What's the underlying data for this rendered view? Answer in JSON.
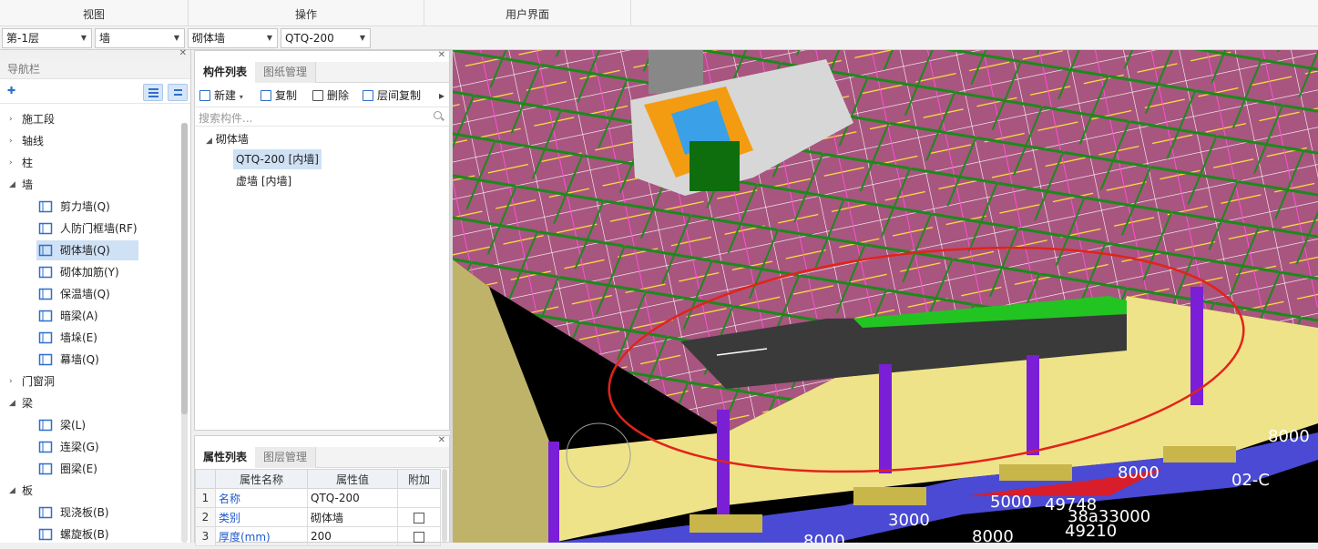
{
  "ribbon": {
    "groups": [
      "视图",
      "操作",
      "用户界面"
    ]
  },
  "selectors": [
    {
      "value": "第-1层"
    },
    {
      "value": "墙"
    },
    {
      "value": "砌体墙"
    },
    {
      "value": "QTQ-200"
    }
  ],
  "nav": {
    "title": "导航栏",
    "items": [
      {
        "type": "cat",
        "label": "施工段",
        "expanded": false
      },
      {
        "type": "cat",
        "label": "轴线",
        "expanded": false
      },
      {
        "type": "cat",
        "label": "柱",
        "expanded": false
      },
      {
        "type": "cat",
        "label": "墙",
        "expanded": true
      },
      {
        "type": "item",
        "label": "剪力墙(Q)",
        "icon": "shear-wall-icon"
      },
      {
        "type": "item",
        "label": "人防门框墙(RF)",
        "icon": "civil-defense-door-wall-icon"
      },
      {
        "type": "item",
        "label": "砌体墙(Q)",
        "icon": "masonry-wall-icon",
        "selected": true
      },
      {
        "type": "item",
        "label": "砌体加筋(Y)",
        "icon": "masonry-rebar-icon"
      },
      {
        "type": "item",
        "label": "保温墙(Q)",
        "icon": "insulation-wall-icon"
      },
      {
        "type": "item",
        "label": "暗梁(A)",
        "icon": "hidden-beam-icon"
      },
      {
        "type": "item",
        "label": "墙垛(E)",
        "icon": "wall-pier-icon"
      },
      {
        "type": "item",
        "label": "幕墙(Q)",
        "icon": "curtain-wall-icon"
      },
      {
        "type": "cat",
        "label": "门窗洞",
        "expanded": false
      },
      {
        "type": "cat",
        "label": "梁",
        "expanded": true
      },
      {
        "type": "item",
        "label": "梁(L)",
        "icon": "beam-icon"
      },
      {
        "type": "item",
        "label": "连梁(G)",
        "icon": "coupling-beam-icon"
      },
      {
        "type": "item",
        "label": "圈梁(E)",
        "icon": "ring-beam-icon"
      },
      {
        "type": "cat",
        "label": "板",
        "expanded": true
      },
      {
        "type": "item",
        "label": "现浇板(B)",
        "icon": "cast-slab-icon"
      },
      {
        "type": "item",
        "label": "螺旋板(B)",
        "icon": "spiral-slab-icon"
      }
    ]
  },
  "component_panel": {
    "tabs": [
      "构件列表",
      "图纸管理"
    ],
    "toolbar": {
      "new": "新建",
      "copy": "复制",
      "delete": "删除",
      "floor_copy": "层间复制"
    },
    "search_placeholder": "搜索构件...",
    "tree_root": "砌体墙",
    "tree_items": [
      "QTQ-200 [内墙]",
      "虚墙 [内墙]"
    ]
  },
  "property_panel": {
    "tabs": [
      "属性列表",
      "图层管理"
    ],
    "headers": [
      "属性名称",
      "属性值",
      "附加"
    ],
    "rows": [
      {
        "n": "1",
        "name": "名称",
        "value": "QTQ-200"
      },
      {
        "n": "2",
        "name": "类别",
        "value": "砌体墙"
      },
      {
        "n": "3",
        "name": "厚度(mm)",
        "value": "200"
      }
    ]
  },
  "viewport_labels": [
    "8000",
    "8000",
    "5000",
    "49748",
    "38a33000",
    "49210",
    "3000",
    "8000",
    "02-C",
    "8000"
  ],
  "colors": {
    "slab": "#a8557f",
    "wall": "#efe38a",
    "column": "#7a1fd6",
    "selection_circle": "#e2231a"
  }
}
